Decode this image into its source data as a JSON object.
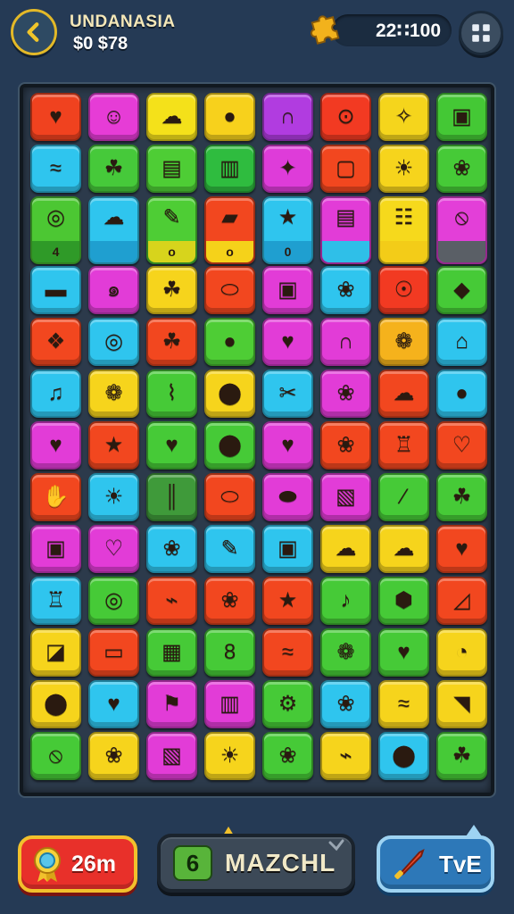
{
  "header": {
    "title": "UNDANASIA",
    "money": "$0 $78",
    "score": "22∷100",
    "back_icon": "back-arrow-icon",
    "puzzle_icon": "puzzle-piece-icon",
    "settings_icon": "grid-plus-icon"
  },
  "board": {
    "columns": 8,
    "rows": 13,
    "tiles": [
      {
        "row": 0,
        "col": 0,
        "color": "#f0421f",
        "glyph": "♥"
      },
      {
        "row": 0,
        "col": 1,
        "color": "#e63cd6",
        "glyph": "☺"
      },
      {
        "row": 0,
        "col": 2,
        "color": "#f4e11a",
        "glyph": "☁"
      },
      {
        "row": 0,
        "col": 3,
        "color": "#f7d11c",
        "glyph": "●"
      },
      {
        "row": 0,
        "col": 4,
        "color": "#b13ce0",
        "glyph": "∩"
      },
      {
        "row": 0,
        "col": 5,
        "color": "#f23a22",
        "glyph": "⊙"
      },
      {
        "row": 0,
        "col": 6,
        "color": "#f5d51c",
        "glyph": "✧"
      },
      {
        "row": 0,
        "col": 7,
        "color": "#44c835",
        "glyph": "▣"
      },
      {
        "row": 1,
        "col": 0,
        "color": "#2fc5ee",
        "glyph": "≈"
      },
      {
        "row": 1,
        "col": 1,
        "color": "#46c93a",
        "glyph": "☘"
      },
      {
        "row": 1,
        "col": 2,
        "color": "#4ecd35",
        "glyph": "▤"
      },
      {
        "row": 1,
        "col": 3,
        "color": "#2fbc3f",
        "glyph": "▥"
      },
      {
        "row": 1,
        "col": 4,
        "color": "#de3cd9",
        "glyph": "✦"
      },
      {
        "row": 1,
        "col": 5,
        "color": "#f2471f",
        "glyph": "▢"
      },
      {
        "row": 1,
        "col": 6,
        "color": "#f6d41c",
        "glyph": "☀"
      },
      {
        "row": 1,
        "col": 7,
        "color": "#46ca37",
        "glyph": "❀"
      },
      {
        "row": 2,
        "col": 0,
        "color": "#4cc733",
        "glyph": "◎",
        "sub": "4",
        "sub_color": "#2f9a28",
        "tall": true
      },
      {
        "row": 2,
        "col": 1,
        "color": "#2fc5ee",
        "glyph": "☁",
        "sub": "",
        "sub_color": "#1f9fd0",
        "tall": true
      },
      {
        "row": 2,
        "col": 2,
        "color": "#4ecd35",
        "glyph": "✎",
        "sub": "o",
        "sub_color": "#d7d41c",
        "tall": true
      },
      {
        "row": 2,
        "col": 3,
        "color": "#f2471f",
        "glyph": "▰",
        "sub": "o",
        "sub_color": "#f5d21a",
        "tall": true
      },
      {
        "row": 2,
        "col": 4,
        "color": "#2fc5ee",
        "glyph": "★",
        "sub": "0",
        "sub_color": "#1f9fd0",
        "tall": true
      },
      {
        "row": 2,
        "col": 5,
        "color": "#e23cd7",
        "glyph": "▤",
        "sub": "",
        "sub_color": "#2fbfe8",
        "tall": true
      },
      {
        "row": 2,
        "col": 6,
        "color": "#f6d91c",
        "glyph": "☷",
        "sub": "",
        "sub_color": "#f3cc18",
        "tall": true
      },
      {
        "row": 2,
        "col": 7,
        "color": "#e33fd8",
        "glyph": "⦸",
        "sub": "",
        "sub_color": "#5a5f66",
        "tall": true
      },
      {
        "row": 3,
        "col": 0,
        "color": "#2fc5ee",
        "glyph": "▬"
      },
      {
        "row": 3,
        "col": 1,
        "color": "#e23cd7",
        "glyph": "๑"
      },
      {
        "row": 3,
        "col": 2,
        "color": "#f6d41c",
        "glyph": "☘"
      },
      {
        "row": 3,
        "col": 3,
        "color": "#f2471f",
        "glyph": "⬭"
      },
      {
        "row": 3,
        "col": 4,
        "color": "#e23cd7",
        "glyph": "▣"
      },
      {
        "row": 3,
        "col": 5,
        "color": "#2fc5ee",
        "glyph": "❀"
      },
      {
        "row": 3,
        "col": 6,
        "color": "#f23a22",
        "glyph": "☉"
      },
      {
        "row": 3,
        "col": 7,
        "color": "#46ca37",
        "glyph": "◆"
      },
      {
        "row": 4,
        "col": 0,
        "color": "#f2471f",
        "glyph": "❖"
      },
      {
        "row": 4,
        "col": 1,
        "color": "#2fc5ee",
        "glyph": "◎"
      },
      {
        "row": 4,
        "col": 2,
        "color": "#f2471f",
        "glyph": "☘"
      },
      {
        "row": 4,
        "col": 3,
        "color": "#4ecd35",
        "glyph": "●"
      },
      {
        "row": 4,
        "col": 4,
        "color": "#e23cd7",
        "glyph": "♥"
      },
      {
        "row": 4,
        "col": 5,
        "color": "#e23cd7",
        "glyph": "∩"
      },
      {
        "row": 4,
        "col": 6,
        "color": "#f5b21c",
        "glyph": "❁"
      },
      {
        "row": 4,
        "col": 7,
        "color": "#2fc5ee",
        "glyph": "⌂"
      },
      {
        "row": 5,
        "col": 0,
        "color": "#2fc5ee",
        "glyph": "♫"
      },
      {
        "row": 5,
        "col": 1,
        "color": "#f6d41c",
        "glyph": "❁"
      },
      {
        "row": 5,
        "col": 2,
        "color": "#46ca37",
        "glyph": "⌇"
      },
      {
        "row": 5,
        "col": 3,
        "color": "#f6d41c",
        "glyph": "⬤"
      },
      {
        "row": 5,
        "col": 4,
        "color": "#2fc5ee",
        "glyph": "✂"
      },
      {
        "row": 5,
        "col": 5,
        "color": "#e23cd7",
        "glyph": "❀"
      },
      {
        "row": 5,
        "col": 6,
        "color": "#f2471f",
        "glyph": "☁"
      },
      {
        "row": 5,
        "col": 7,
        "color": "#2fc5ee",
        "glyph": "●"
      },
      {
        "row": 6,
        "col": 0,
        "color": "#e23cd7",
        "glyph": "♥"
      },
      {
        "row": 6,
        "col": 1,
        "color": "#f2471f",
        "glyph": "★"
      },
      {
        "row": 6,
        "col": 2,
        "color": "#46ca37",
        "glyph": "♥"
      },
      {
        "row": 6,
        "col": 3,
        "color": "#46ca37",
        "glyph": "⬤"
      },
      {
        "row": 6,
        "col": 4,
        "color": "#e23cd7",
        "glyph": "♥"
      },
      {
        "row": 6,
        "col": 5,
        "color": "#f2471f",
        "glyph": "❀"
      },
      {
        "row": 6,
        "col": 6,
        "color": "#f2471f",
        "glyph": "♖"
      },
      {
        "row": 6,
        "col": 7,
        "color": "#f2471f",
        "glyph": "♡"
      },
      {
        "row": 7,
        "col": 0,
        "color": "#f2471f",
        "glyph": "✋"
      },
      {
        "row": 7,
        "col": 1,
        "color": "#2fc5ee",
        "glyph": "☀"
      },
      {
        "row": 7,
        "col": 2,
        "color": "#3f9a3a",
        "glyph": "║"
      },
      {
        "row": 7,
        "col": 3,
        "color": "#f2471f",
        "glyph": "⬭"
      },
      {
        "row": 7,
        "col": 4,
        "color": "#e23cd7",
        "glyph": "⬬"
      },
      {
        "row": 7,
        "col": 5,
        "color": "#e23cd7",
        "glyph": "▧"
      },
      {
        "row": 7,
        "col": 6,
        "color": "#46ca37",
        "glyph": "∕"
      },
      {
        "row": 7,
        "col": 7,
        "color": "#46ca37",
        "glyph": "☘"
      },
      {
        "row": 8,
        "col": 0,
        "color": "#e23cd7",
        "glyph": "▣"
      },
      {
        "row": 8,
        "col": 1,
        "color": "#e23cd7",
        "glyph": "♡"
      },
      {
        "row": 8,
        "col": 2,
        "color": "#2fc5ee",
        "glyph": "❀"
      },
      {
        "row": 8,
        "col": 3,
        "color": "#2fc5ee",
        "glyph": "✎"
      },
      {
        "row": 8,
        "col": 4,
        "color": "#2fc5ee",
        "glyph": "▣"
      },
      {
        "row": 8,
        "col": 5,
        "color": "#f6d41c",
        "glyph": "☁"
      },
      {
        "row": 8,
        "col": 6,
        "color": "#f6d41c",
        "glyph": "☁"
      },
      {
        "row": 8,
        "col": 7,
        "color": "#f2471f",
        "glyph": "♥"
      },
      {
        "row": 9,
        "col": 0,
        "color": "#2fc5ee",
        "glyph": "♖"
      },
      {
        "row": 9,
        "col": 1,
        "color": "#46ca37",
        "glyph": "◎"
      },
      {
        "row": 9,
        "col": 2,
        "color": "#f2471f",
        "glyph": "⌁"
      },
      {
        "row": 9,
        "col": 3,
        "color": "#f2471f",
        "glyph": "❀"
      },
      {
        "row": 9,
        "col": 4,
        "color": "#f2471f",
        "glyph": "★"
      },
      {
        "row": 9,
        "col": 5,
        "color": "#46ca37",
        "glyph": "♪"
      },
      {
        "row": 9,
        "col": 6,
        "color": "#46ca37",
        "glyph": "⬢"
      },
      {
        "row": 9,
        "col": 7,
        "color": "#f2471f",
        "glyph": "◿"
      },
      {
        "row": 10,
        "col": 0,
        "color": "#f6d41c",
        "glyph": "◪"
      },
      {
        "row": 10,
        "col": 1,
        "color": "#f2471f",
        "glyph": "▭"
      },
      {
        "row": 10,
        "col": 2,
        "color": "#46ca37",
        "glyph": "▦"
      },
      {
        "row": 10,
        "col": 3,
        "color": "#46ca37",
        "glyph": "8"
      },
      {
        "row": 10,
        "col": 4,
        "color": "#f2471f",
        "glyph": "≈"
      },
      {
        "row": 10,
        "col": 5,
        "color": "#46ca37",
        "glyph": "❁"
      },
      {
        "row": 10,
        "col": 6,
        "color": "#46ca37",
        "glyph": "♥"
      },
      {
        "row": 10,
        "col": 7,
        "color": "#f6d41c",
        "glyph": "◔"
      },
      {
        "row": 11,
        "col": 0,
        "color": "#f6d41c",
        "glyph": "⬤"
      },
      {
        "row": 11,
        "col": 1,
        "color": "#2fc5ee",
        "glyph": "♥"
      },
      {
        "row": 11,
        "col": 2,
        "color": "#e23cd7",
        "glyph": "⚑"
      },
      {
        "row": 11,
        "col": 3,
        "color": "#e23cd7",
        "glyph": "▥"
      },
      {
        "row": 11,
        "col": 4,
        "color": "#46ca37",
        "glyph": "⚙"
      },
      {
        "row": 11,
        "col": 5,
        "color": "#2fc5ee",
        "glyph": "❀"
      },
      {
        "row": 11,
        "col": 6,
        "color": "#f6d41c",
        "glyph": "≈"
      },
      {
        "row": 11,
        "col": 7,
        "color": "#f6d41c",
        "glyph": "◥"
      },
      {
        "row": 12,
        "col": 0,
        "color": "#46ca37",
        "glyph": "⦸"
      },
      {
        "row": 12,
        "col": 1,
        "color": "#f6d41c",
        "glyph": "❀"
      },
      {
        "row": 12,
        "col": 2,
        "color": "#e23cd7",
        "glyph": "▧"
      },
      {
        "row": 12,
        "col": 3,
        "color": "#f6d41c",
        "glyph": "☀"
      },
      {
        "row": 12,
        "col": 4,
        "color": "#46ca37",
        "glyph": "❀"
      },
      {
        "row": 12,
        "col": 5,
        "color": "#f6d41c",
        "glyph": "⌁"
      },
      {
        "row": 12,
        "col": 6,
        "color": "#2fc5ee",
        "glyph": "⬤"
      },
      {
        "row": 12,
        "col": 7,
        "color": "#46ca37",
        "glyph": "☘"
      }
    ]
  },
  "footer": {
    "time_label": "26m",
    "match_label": "MAZCHL",
    "match_icon_glyph": "6",
    "tve_label": "TvE",
    "time_icon": "medal-icon",
    "tve_icon": "knife-icon"
  },
  "colors": {
    "background": "#253a55",
    "gold": "#e3b928",
    "red_button": "#e8302a",
    "blue_button": "#2d78b8"
  }
}
